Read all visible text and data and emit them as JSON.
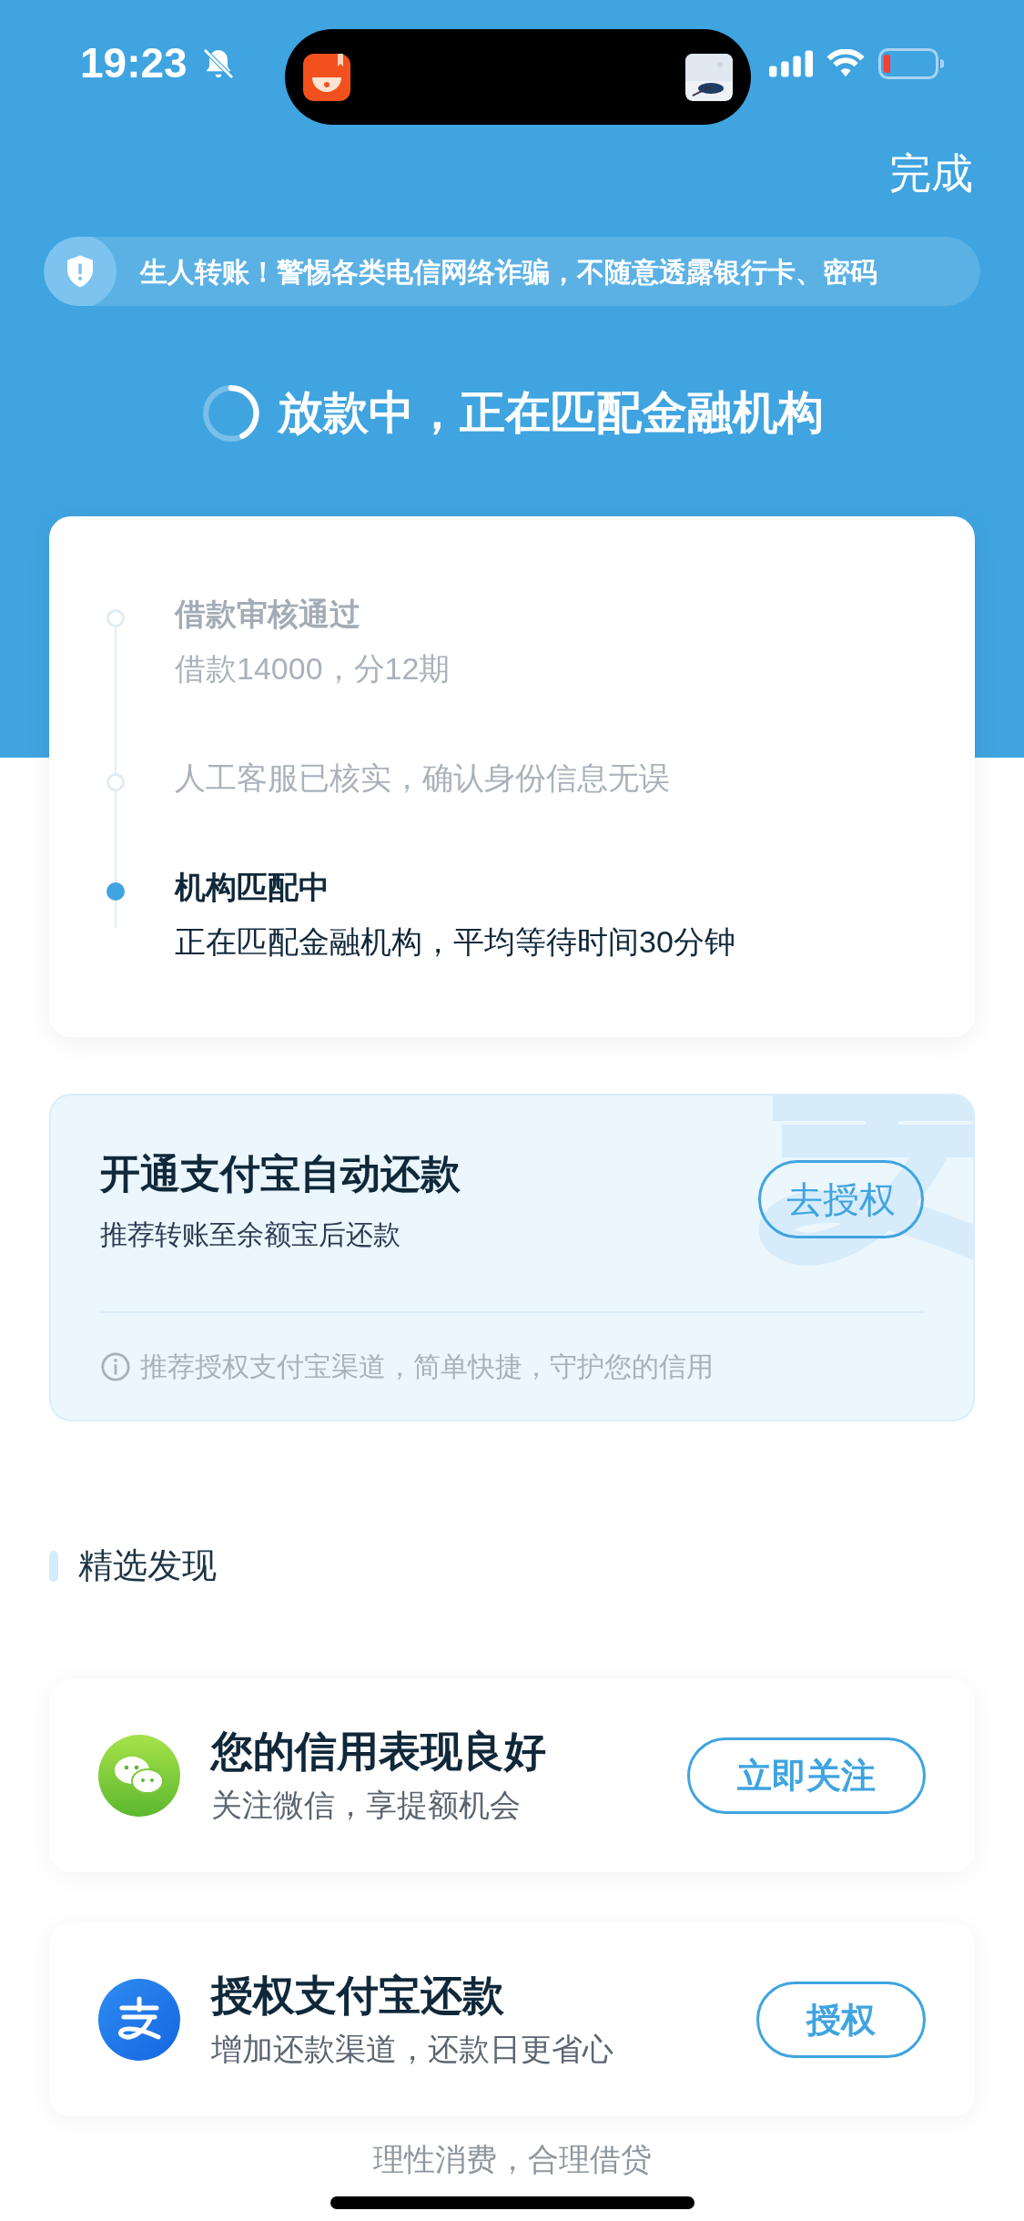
{
  "status_bar": {
    "time": "19:23"
  },
  "header": {
    "done_button": "完成",
    "notice": "生人转账！警惕各类电信网络诈骗，不随意透露银行卡、密码",
    "status": "放款中，正在匹配金融机构"
  },
  "timeline": {
    "steps": [
      {
        "title": "借款审核通过",
        "detail": "借款14000，分12期",
        "current": false
      },
      {
        "detail": "人工客服已核实，确认身份信息无误",
        "current": false
      },
      {
        "title": "机构匹配中",
        "detail": "正在匹配金融机构，平均等待时间30分钟",
        "current": true
      }
    ]
  },
  "autopay_card": {
    "title": "开通支付宝自动还款",
    "subtitle": "推荐转账至余额宝后还款",
    "button": "去授权",
    "tip": "推荐授权支付宝渠道，简单快捷，守护您的信用"
  },
  "discover": {
    "section_title": "精选发现",
    "items": [
      {
        "kind": "wechat",
        "title": "您的信用表现良好",
        "subtitle": "关注微信，享提额机会",
        "button": "立即关注"
      },
      {
        "kind": "alipay",
        "title": "授权支付宝还款",
        "subtitle": "增加还款渠道，还款日更省心",
        "button": "授权"
      }
    ]
  },
  "footer": {
    "slogan": "理性消费，合理借贷"
  }
}
